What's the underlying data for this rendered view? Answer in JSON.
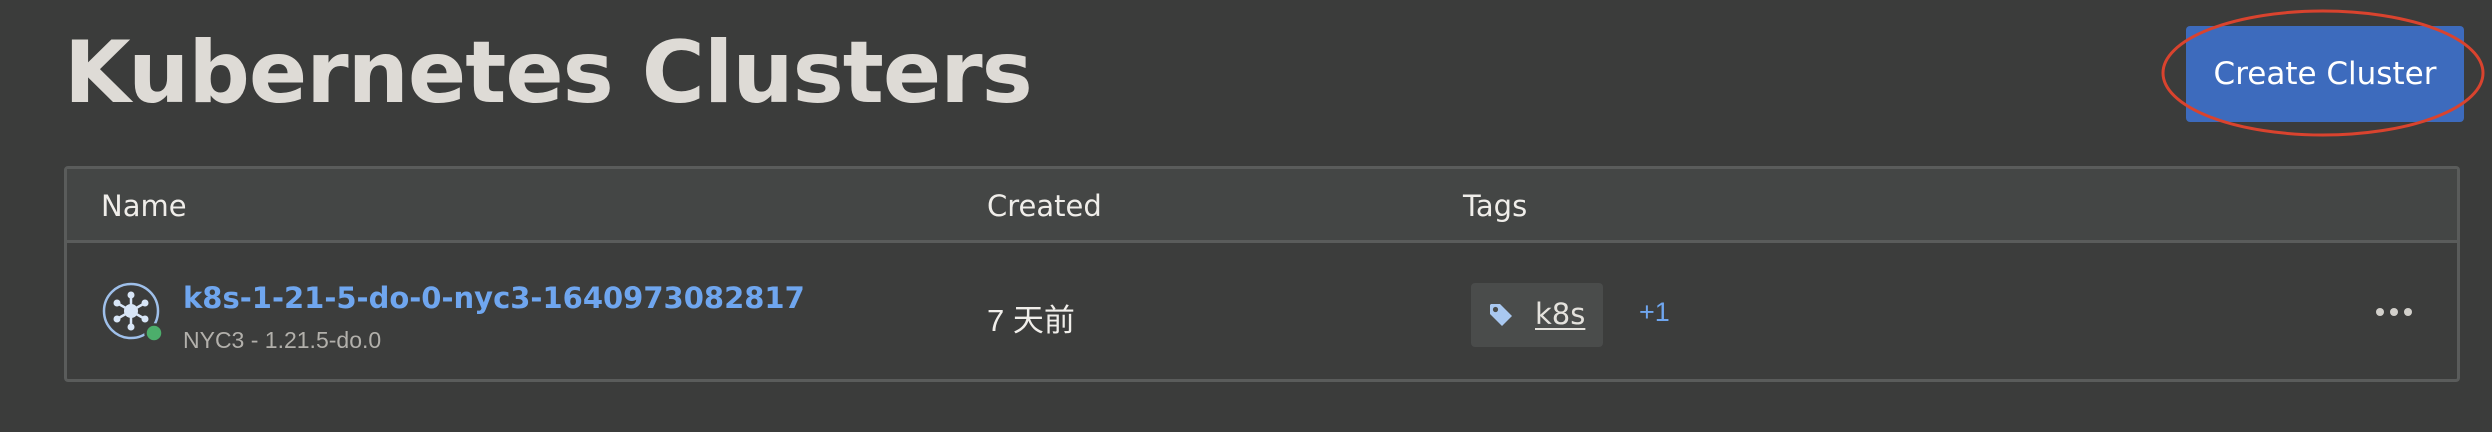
{
  "header": {
    "title": "Kubernetes Clusters",
    "create_button_label": "Create Cluster"
  },
  "table": {
    "columns": [
      "Name",
      "Created",
      "Tags"
    ],
    "rows": [
      {
        "name": "k8s-1-21-5-do-0-nyc3-1640973082817",
        "meta": "NYC3 - 1.21.5-do.0",
        "status": "running",
        "created": "7 天前",
        "tag": "k8s",
        "more_tags": "+1"
      }
    ]
  },
  "icons": {
    "cluster": "kubernetes-cluster-icon",
    "tag": "tag-icon",
    "more": "ellipsis-icon"
  },
  "colors": {
    "background": "#3b3c3b",
    "accent": "#3d6bbd",
    "link": "#6fa6ef",
    "status_ok": "#4cae6b",
    "highlight": "#d9432e"
  }
}
